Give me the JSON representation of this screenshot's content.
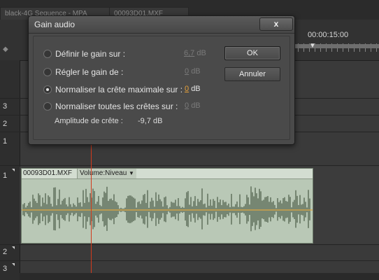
{
  "tabs": [
    {
      "label": "black-4G Sequence - MPA"
    },
    {
      "label": "00093D01.MXF"
    }
  ],
  "ruler": {
    "timecode": "00:00:15:00"
  },
  "tracks": {
    "video": [
      "3",
      "2",
      "1"
    ],
    "audio": [
      "1",
      "2",
      "3"
    ]
  },
  "clip": {
    "name": "00093D01.MXF",
    "param": "Volume:Niveau"
  },
  "dialog": {
    "title": "Gain audio",
    "close_label": "x",
    "options": [
      {
        "label": "Définir le gain sur :",
        "value": "6,7",
        "unit": "dB",
        "selected": false
      },
      {
        "label": "Régler le gain de :",
        "value": "0",
        "unit": "dB",
        "selected": false
      },
      {
        "label": "Normaliser la crête maximale sur :",
        "value": "0",
        "unit": "dB",
        "selected": true
      },
      {
        "label": "Normaliser toutes les crêtes sur :",
        "value": "0",
        "unit": "dB",
        "selected": false
      }
    ],
    "amplitude_label": "Amplitude de crête :",
    "amplitude_value": "-9,7 dB",
    "ok_label": "OK",
    "cancel_label": "Annuler"
  },
  "colors": {
    "playhead": "#d23a1c",
    "clip_bg": "#b9c8b6",
    "waveform": "#5a6a56",
    "gain_line": "#e0a640",
    "active_value": "#e8a23a"
  },
  "icons": {
    "close": "close-icon",
    "dropdown": "chevron-down-icon",
    "playhead_marker": "playhead-marker-icon"
  }
}
